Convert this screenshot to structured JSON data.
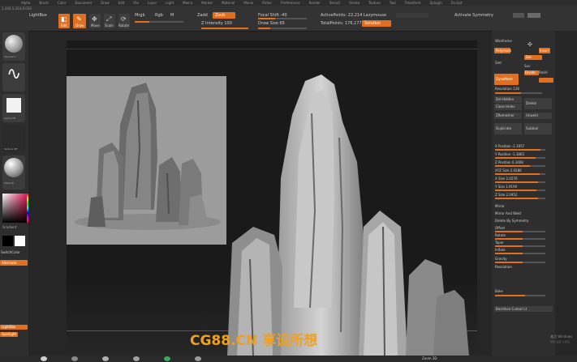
{
  "menu": [
    "Alpha",
    "Brush",
    "Color",
    "Document",
    "Draw",
    "Edit",
    "File",
    "Layer",
    "Light",
    "Macro",
    "Marker",
    "Material",
    "Movie",
    "Picker",
    "Preferences",
    "Render",
    "Stencil",
    "Stroke",
    "Texture",
    "Tool",
    "Transform",
    "Zplugin",
    "Zscript"
  ],
  "shelf": {
    "coords": "1.243,1.314,0.034",
    "brush_name": "LightBox",
    "edit": "Edit",
    "draw": "Draw",
    "move": "Move",
    "scale": "Scale",
    "rotate": "Rotate",
    "mrgb": "Mrgb",
    "rgb": "Rgb",
    "m": "M",
    "zadd": "Zadd",
    "zsub": "Zsub",
    "z_intensity": "Z Intensity 100",
    "focal_shift": "Focal Shift -40",
    "draw_size": "Draw Size 65",
    "active_points": "ActivePoints: 22,214 Lazymouse",
    "total_points": "TotalPoints: 176,177",
    "solution": "Solution",
    "activate_symmetry": "Activate Symmetry"
  },
  "left": {
    "brush_label": "Standard",
    "alpha_label": "Alpha Off",
    "texture_label": "Texture Off",
    "material_label": "Material",
    "gradient": "Gradient",
    "switch_color": "SwitchColor",
    "alternate": "Alternate",
    "bottom1": "LightBox",
    "bottom2": "Spotlight"
  },
  "right": {
    "title": "Polymesh",
    "wireframe": "Wireframe",
    "insert": "Insert",
    "del": "Del",
    "divide": "Divide",
    "smt": "Smt",
    "suv": "Suv",
    "reuv": "ReUV",
    "dynamesh": "DynaMesh",
    "resolution": "Resolution 128",
    "del_hidden": "Del Hidden",
    "close_holes": "Close Holes",
    "delete": "Delete",
    "zremesher": "ZRemesher",
    "unweld": "Unweld",
    "dup": "Duplicate",
    "subtool": "Subtool",
    "x_position": "X Position -1.1957",
    "y_position": "Y Position -1.3865",
    "z_position": "Z Position 0.3408",
    "xyz_size": "XYZ Size 2.0286",
    "x_size": "X Size 2.0576",
    "y_size": "Y Size 1.9190",
    "z_size": "Z Size 2.0952",
    "mirror": "Mirror",
    "mirror_and_weld": "Mirror And Weld",
    "delete_by_symmetry": "Delete By Symmetry",
    "offset": "Offset",
    "rotate": "Rotate",
    "taper": "Taper",
    "inflate": "Inflate",
    "gravity": "Gravity",
    "resolution2": "Resolution",
    "bake": "Bake",
    "subsurface": "Backface Cutout Lt"
  },
  "bottom": {
    "zoom": "Zoom 3D"
  },
  "watermark": "CG88.CN 享设所想",
  "watermark_small": "激活 Windows",
  "watermark_small2": "转到\"设置\"以激活"
}
